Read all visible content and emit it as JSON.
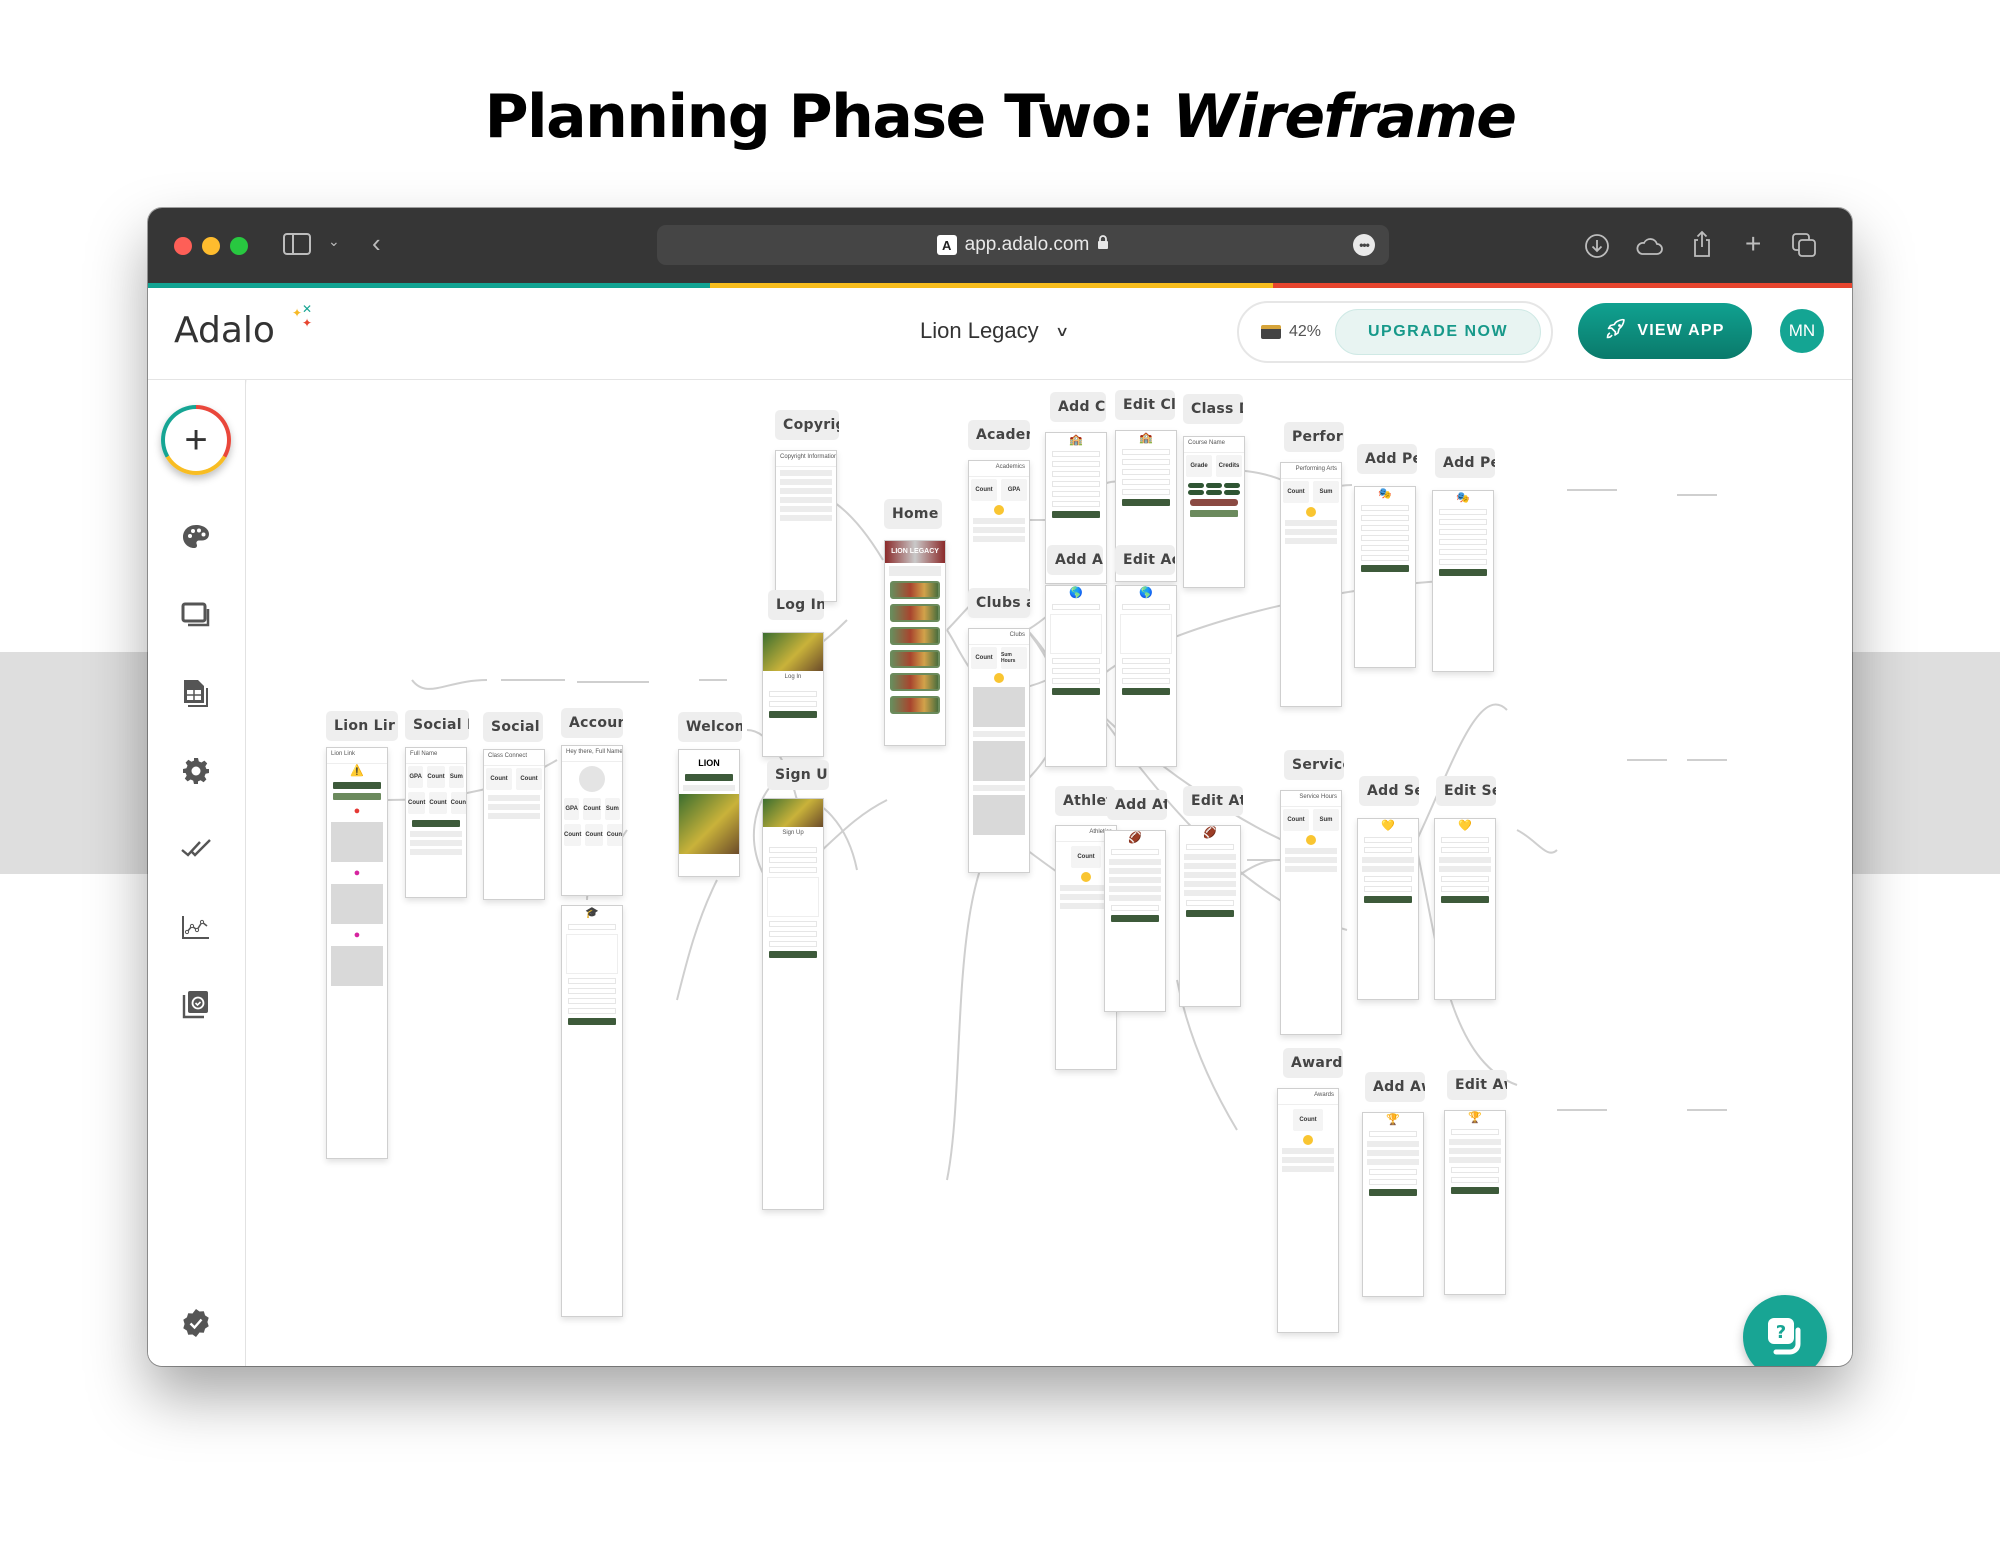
{
  "headline": {
    "prefix": "Planning Phase Two: ",
    "emphasis": "Wireframe"
  },
  "browser": {
    "url": "app.adalo.com",
    "icons": [
      "sidebar-toggle-icon",
      "chevron-down-icon",
      "back-icon",
      "lock-icon",
      "more-icon",
      "download-icon",
      "cloud-icon",
      "share-icon",
      "new-tab-icon",
      "tabs-overview-icon"
    ],
    "accent_strip": [
      "#12a392",
      "#f7bd1d",
      "#e7452f"
    ]
  },
  "appbar": {
    "logo": "Adalo",
    "app_name": "Lion Legacy",
    "storage_percent": "42%",
    "upgrade_label": "UPGRADE NOW",
    "view_app_label": "VIEW APP",
    "avatar_initials": "MN",
    "brand_color": "#14a593"
  },
  "sidebar": {
    "items": [
      {
        "name": "add-component",
        "icon": "plus-icon"
      },
      {
        "name": "branding",
        "icon": "palette-icon"
      },
      {
        "name": "screens",
        "icon": "screens-icon"
      },
      {
        "name": "database",
        "icon": "database-icon"
      },
      {
        "name": "settings",
        "icon": "gear-icon"
      },
      {
        "name": "publish",
        "icon": "double-check-icon"
      },
      {
        "name": "analytics",
        "icon": "analytics-icon"
      },
      {
        "name": "version-history",
        "icon": "version-icon"
      },
      {
        "name": "verified",
        "icon": "verified-badge-icon"
      }
    ]
  },
  "screens": [
    {
      "id": "lion-link",
      "label": "Lion Lir",
      "header": "Lion Link"
    },
    {
      "id": "social-profile",
      "label": "Social F",
      "header": "Full Name",
      "cards": [
        "GPA",
        "Count",
        "Sum",
        "Count",
        "Count",
        "Count"
      ]
    },
    {
      "id": "social",
      "label": "Social",
      "header": "Class Connect",
      "cards": [
        "Count",
        "Count"
      ]
    },
    {
      "id": "account",
      "label": "Accoun",
      "header": "Hey there, Full Name.",
      "cards": [
        "GPA",
        "Count",
        "Sum",
        "Count",
        "Count",
        "Count"
      ]
    },
    {
      "id": "welcome",
      "label": "Welcom",
      "header": "LION"
    },
    {
      "id": "copyright",
      "label": "Copyrig",
      "header": "Copyright Information"
    },
    {
      "id": "log-in",
      "label": "Log In",
      "header": "Log In"
    },
    {
      "id": "sign-up",
      "label": "Sign Up",
      "header": "Sign Up"
    },
    {
      "id": "home",
      "label": "Home",
      "header": "LION LEGACY"
    },
    {
      "id": "academics",
      "label": "Academ",
      "header": "Academics",
      "cards": [
        "Count",
        "GPA"
      ]
    },
    {
      "id": "clubs",
      "label": "Clubs a",
      "header": "Clubs",
      "cards": [
        "Count",
        "Sum Hours"
      ]
    },
    {
      "id": "add-class",
      "label": "Add Cla",
      "header": ""
    },
    {
      "id": "edit-class",
      "label": "Edit Cla",
      "header": ""
    },
    {
      "id": "class-detail",
      "label": "Class D",
      "header": "Course Name",
      "cards": [
        "Grade",
        "Credits"
      ]
    },
    {
      "id": "add-activity",
      "label": "Add Act",
      "header": ""
    },
    {
      "id": "edit-activity",
      "label": "Edit Ac",
      "header": ""
    },
    {
      "id": "athletics",
      "label": "Athletic",
      "header": "Athletics",
      "cards": [
        "Count"
      ]
    },
    {
      "id": "add-athletics",
      "label": "Add Ath",
      "header": ""
    },
    {
      "id": "edit-athletics",
      "label": "Edit Ath",
      "header": ""
    },
    {
      "id": "performing-arts",
      "label": "Perform",
      "header": "Performing Arts",
      "cards": [
        "Count",
        "Sum"
      ]
    },
    {
      "id": "add-performing-1",
      "label": "Add Pe",
      "header": ""
    },
    {
      "id": "add-performing-2",
      "label": "Add Pe",
      "header": ""
    },
    {
      "id": "service",
      "label": "Service",
      "header": "Service Hours",
      "cards": [
        "Count",
        "Sum"
      ]
    },
    {
      "id": "add-service",
      "label": "Add Se",
      "header": ""
    },
    {
      "id": "edit-service",
      "label": "Edit Se",
      "header": ""
    },
    {
      "id": "awards",
      "label": "Awards",
      "header": "Awards",
      "cards": [
        "Count"
      ]
    },
    {
      "id": "add-award",
      "label": "Add Aw",
      "header": ""
    },
    {
      "id": "edit-award",
      "label": "Edit Aw",
      "header": ""
    }
  ],
  "help": {
    "icon": "help-chat-icon"
  }
}
